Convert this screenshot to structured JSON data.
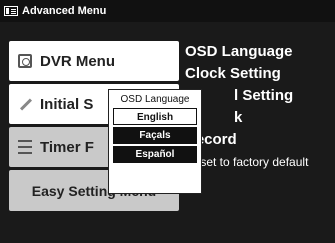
{
  "window": {
    "title": "Advanced Menu"
  },
  "left_menu": {
    "items": [
      {
        "label": "DVR Menu",
        "icon": "dvr-icon"
      },
      {
        "label": "Initial S",
        "icon": "wrench-icon"
      },
      {
        "label": "Timer F",
        "icon": "timer-list-icon"
      },
      {
        "label": "Easy Setting Menu",
        "icon": ""
      }
    ]
  },
  "right_menu": {
    "items": [
      "OSD Language",
      "Clock Setting",
      "l Setting",
      "k",
      "Record",
      "Reset to factory default"
    ]
  },
  "popup": {
    "title": "OSD Language",
    "options": [
      "English",
      "Façals",
      "Español"
    ],
    "selected_index": 0
  }
}
